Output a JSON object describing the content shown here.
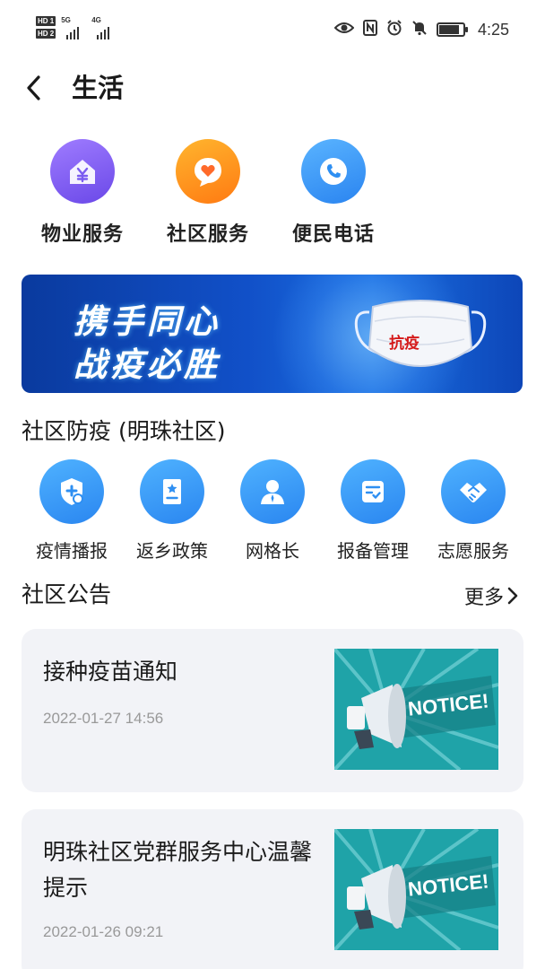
{
  "status_bar": {
    "sim1": "HD 1",
    "sim2": "HD 2",
    "net1": "5G",
    "net2": "4G",
    "time": "4:25",
    "icons": [
      "eye-icon",
      "nfc-icon",
      "alarm-icon",
      "mute-icon",
      "battery-icon"
    ],
    "battery_level": 0.85
  },
  "header": {
    "title": "生活"
  },
  "top_services": [
    {
      "label": "物业服务",
      "icon": "property-icon",
      "color": "#7b5cf0"
    },
    {
      "label": "社区服务",
      "icon": "heart-chat-icon",
      "color": "#ff8a1d"
    },
    {
      "label": "便民电话",
      "icon": "phone-icon",
      "color": "#2e8ff2"
    }
  ],
  "banner": {
    "line1": "携手同心",
    "line2": "战疫必胜",
    "mask_text": "抗疫"
  },
  "epidemic_section": {
    "title": "社区防疫 (明珠社区)",
    "items": [
      {
        "label": "疫情播报",
        "icon": "shield-plus-icon"
      },
      {
        "label": "返乡政策",
        "icon": "policy-doc-icon"
      },
      {
        "label": "网格长",
        "icon": "person-icon"
      },
      {
        "label": "报备管理",
        "icon": "checklist-icon"
      },
      {
        "label": "志愿服务",
        "icon": "handshake-icon"
      }
    ]
  },
  "notices": {
    "title": "社区公告",
    "more_label": "更多",
    "items": [
      {
        "title": "接种疫苗通知",
        "date": "2022-01-27 14:56",
        "image_text": "NOTICE!"
      },
      {
        "title": "明珠社区党群服务中心温馨提示",
        "date": "2022-01-26 09:21",
        "image_text": "NOTICE!"
      }
    ]
  },
  "colors": {
    "accent_blue": "#2e8ff2",
    "card_bg": "#f2f3f7",
    "banner_blue": "#1150c8"
  }
}
